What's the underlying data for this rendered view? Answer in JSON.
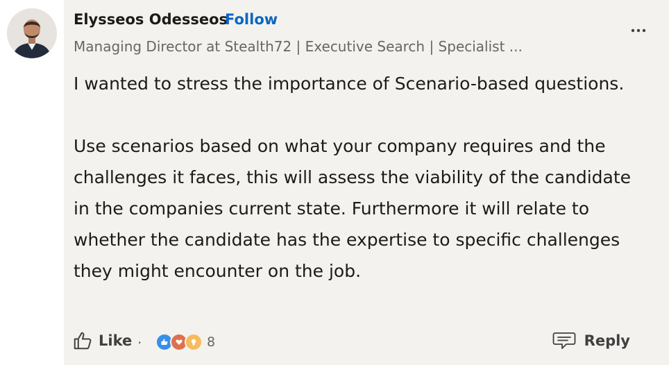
{
  "author": {
    "name": "Elysseos Odesseos",
    "follow_label": "Follow",
    "headline": "Managing Director at Stealth72 | Executive Search | Specialist ..."
  },
  "comment": {
    "paragraph1": "I wanted to stress the importance of Scenario-based questions.",
    "paragraph2": "Use scenarios based on what your company requires and the challenges it faces, this will assess the viability of the candidate in the companies current state. Furthermore it will relate to whether the candidate has the expertise to specific challenges they might encounter on the job."
  },
  "actions": {
    "like_label": "Like",
    "separator": "·",
    "reaction_count": "8",
    "reply_label": "Reply",
    "reactions": [
      "like-icon",
      "love-icon",
      "insightful-icon"
    ]
  },
  "colors": {
    "accent": "#0a66c2",
    "card_bg": "#f4f2ee",
    "like": "#378fe9",
    "love": "#df704d",
    "insightful": "#f5bb5c"
  },
  "icons": {
    "more": "ellipsis-icon",
    "like": "thumbs-up-icon",
    "reply": "speech-bubble-icon"
  }
}
